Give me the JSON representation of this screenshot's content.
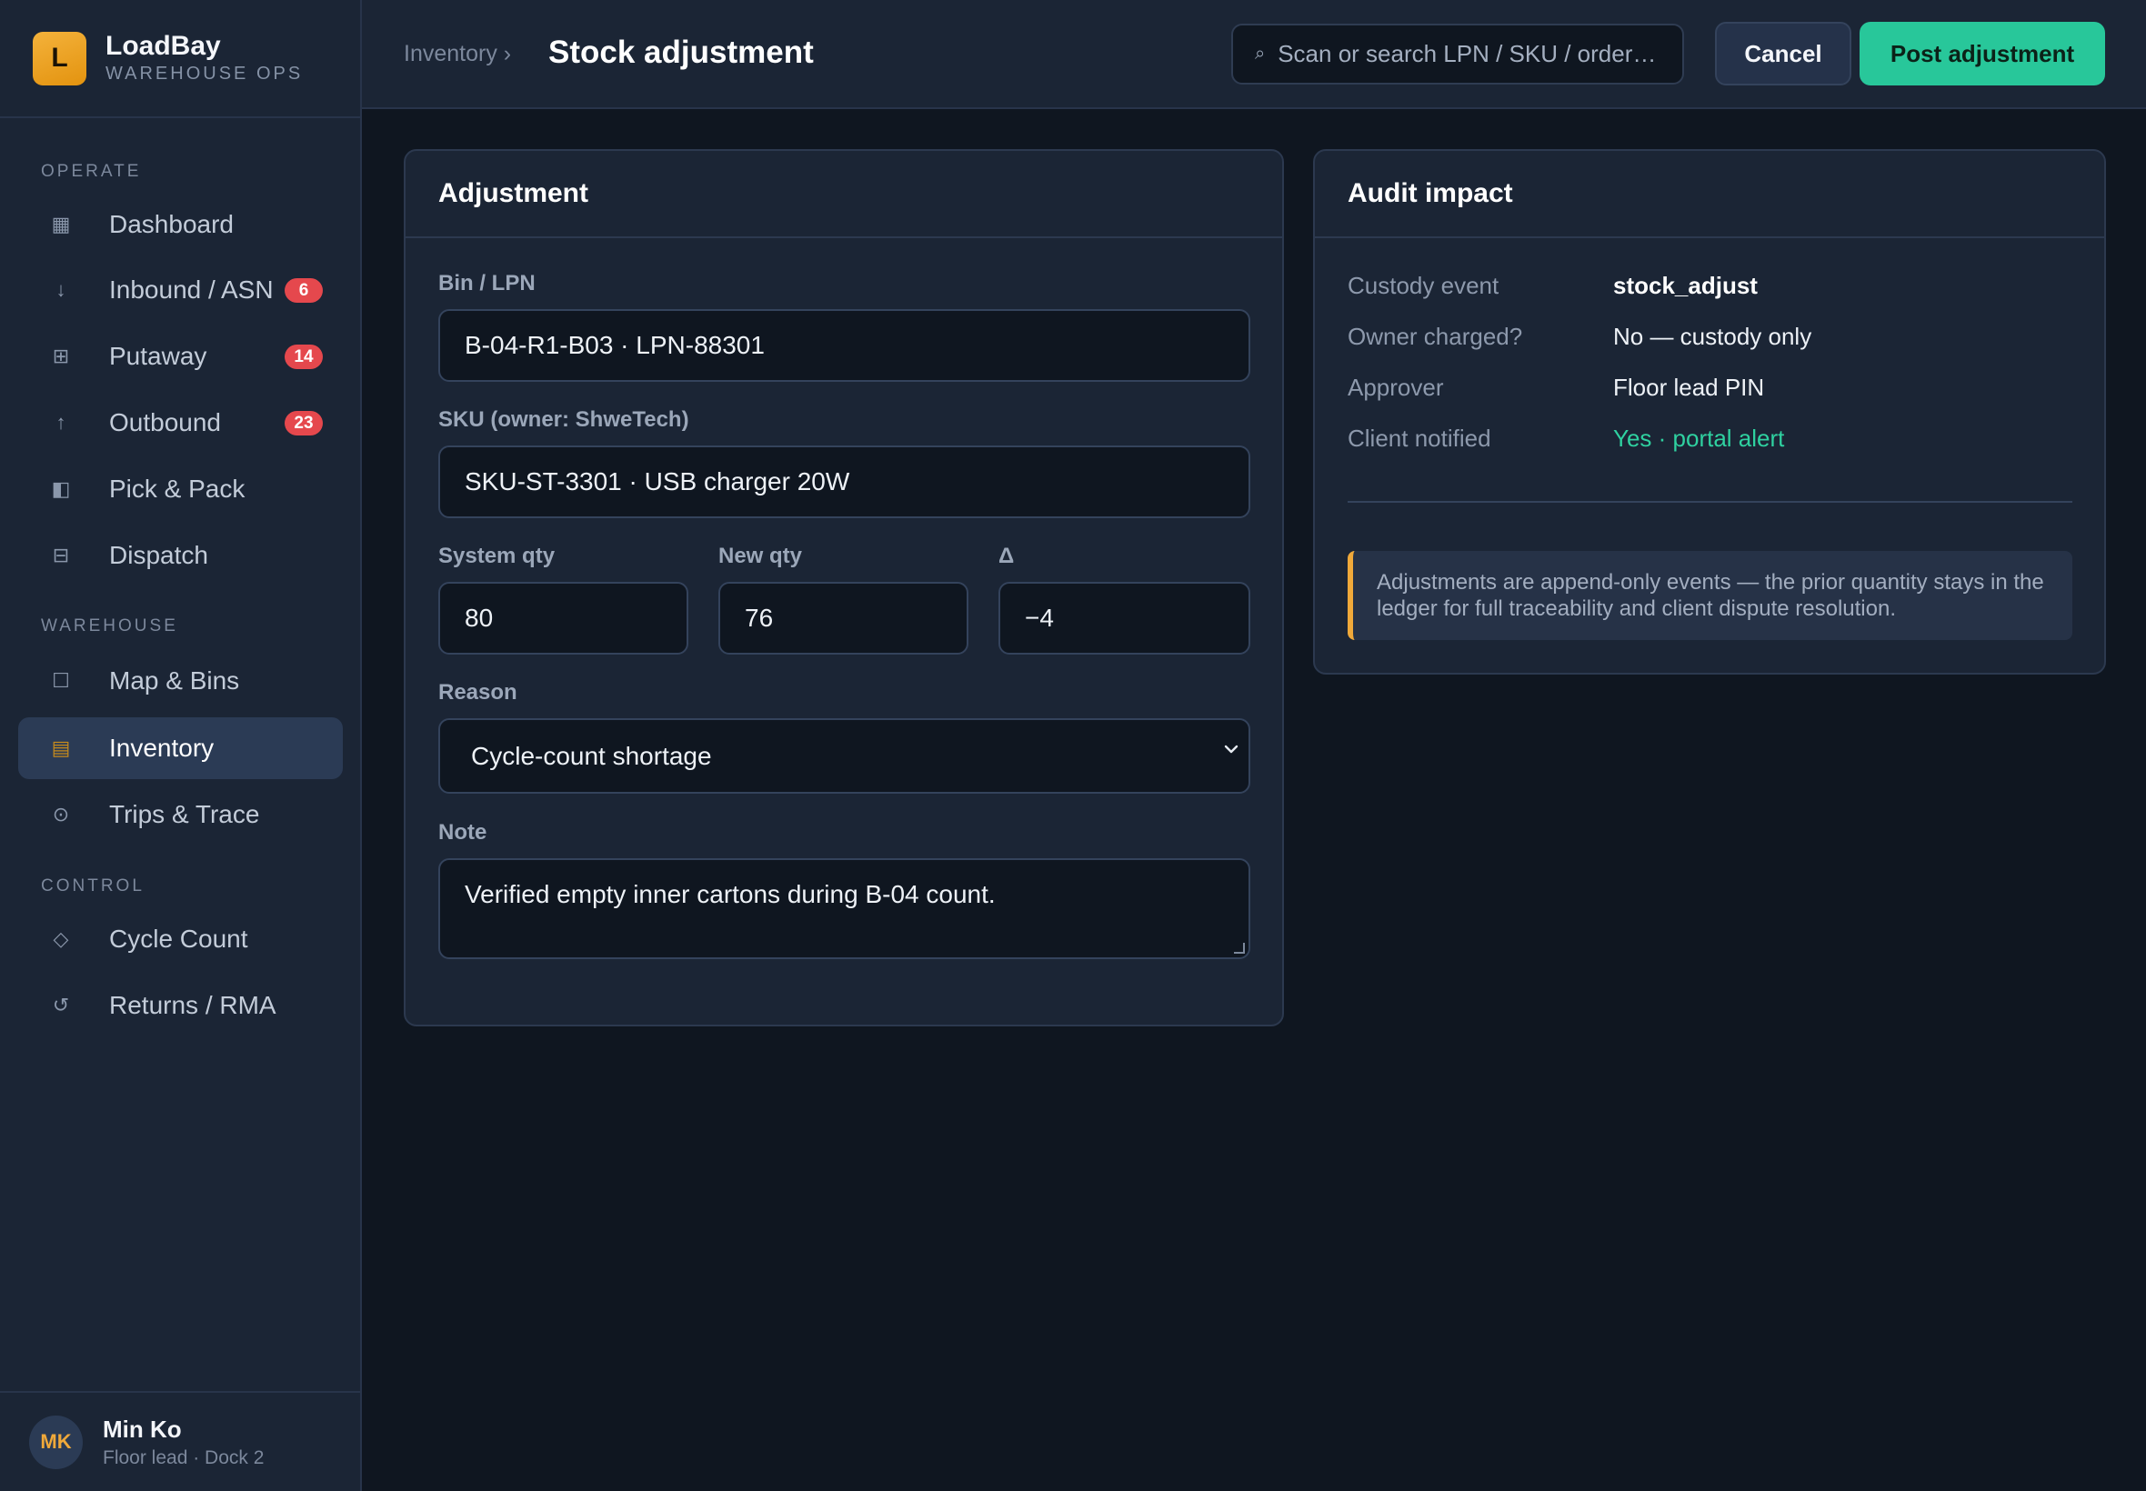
{
  "brand": {
    "logo_letter": "L",
    "name": "LoadBay",
    "subtitle": "WAREHOUSE OPS"
  },
  "sidebar": {
    "sections": [
      "OPERATE",
      "WAREHOUSE",
      "CONTROL"
    ],
    "items": [
      {
        "label": "Dashboard",
        "icon": "dashboard-icon",
        "glyph": "▦"
      },
      {
        "label": "Inbound / ASN",
        "icon": "arrow-down-icon",
        "glyph": "↓",
        "badge": "6"
      },
      {
        "label": "Putaway",
        "icon": "grid-icon",
        "glyph": "⊞",
        "badge": "14"
      },
      {
        "label": "Outbound",
        "icon": "arrow-up-icon",
        "glyph": "↑",
        "badge": "23"
      },
      {
        "label": "Pick & Pack",
        "icon": "half-square-icon",
        "glyph": "◧"
      },
      {
        "label": "Dispatch",
        "icon": "boxed-minus-icon",
        "glyph": "⊟"
      },
      {
        "label": "Map & Bins",
        "icon": "square-icon",
        "glyph": "☐"
      },
      {
        "label": "Inventory",
        "icon": "inventory-icon",
        "glyph": "▤",
        "active": true
      },
      {
        "label": "Trips & Trace",
        "icon": "target-icon",
        "glyph": "⊙"
      },
      {
        "label": "Cycle Count",
        "icon": "diamond-icon",
        "glyph": "◇"
      },
      {
        "label": "Returns / RMA",
        "icon": "return-icon",
        "glyph": "↺"
      }
    ]
  },
  "user": {
    "initials": "MK",
    "name": "Min Ko",
    "role": "Floor lead · Dock 2"
  },
  "header": {
    "breadcrumb": "Inventory ›",
    "title": "Stock adjustment",
    "search_placeholder": "Scan or search LPN / SKU / order…",
    "search_glyph": "⌕",
    "cancel_label": "Cancel",
    "post_label": "Post adjustment"
  },
  "adjustment": {
    "title": "Adjustment",
    "bin_label": "Bin / LPN",
    "bin_value": "B-04-R1-B03 · LPN-88301",
    "sku_label": "SKU (owner: ShweTech)",
    "sku_value": "SKU-ST-3301 · USB charger 20W",
    "system_qty_label": "System qty",
    "system_qty": "80",
    "new_qty_label": "New qty",
    "new_qty": "76",
    "delta_label": "Δ",
    "delta": "−4",
    "reason_label": "Reason",
    "reason_value": "Cycle-count shortage",
    "note_label": "Note",
    "note_value": "Verified empty inner cartons during B-04 count."
  },
  "audit": {
    "title": "Audit impact",
    "rows": [
      {
        "key": "Custody event",
        "value": "stock_adjust"
      },
      {
        "key": "Owner charged?",
        "value": "No — custody only"
      },
      {
        "key": "Approver",
        "value": "Floor lead PIN"
      },
      {
        "key": "Client notified",
        "value": "Yes · portal alert"
      }
    ],
    "callout": "Adjustments are append-only events — the prior quantity stays in the ledger for full traceability and client dispute resolution."
  },
  "colors": {
    "accent": "#28c79a",
    "brand": "#f0a93a",
    "badge": "#e5484d",
    "success_text": "#2fd1a0"
  }
}
